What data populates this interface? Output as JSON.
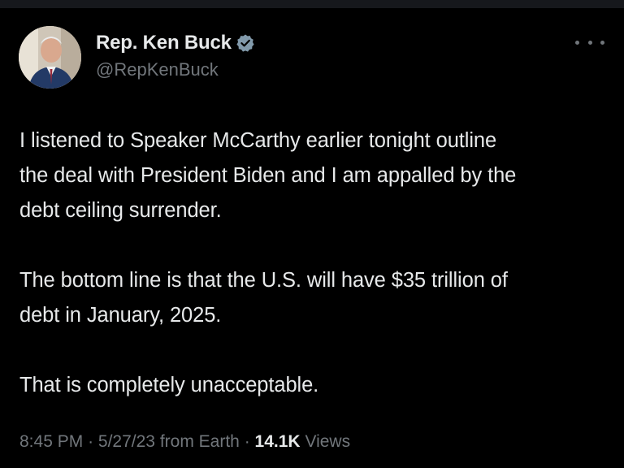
{
  "author": {
    "display_name": "Rep. Ken Buck",
    "handle": "@RepKenBuck",
    "verified_color": "#829aab"
  },
  "tweet": {
    "paragraphs": [
      [
        "I listened to Speaker McCarthy earlier tonight outline",
        "the deal with President Biden and I am appalled by the",
        "debt ceiling surrender."
      ],
      [
        "The bottom line is that the U.S. will have $35 trillion of",
        "debt in January, 2025."
      ],
      [
        "That is completely unacceptable."
      ]
    ]
  },
  "meta": {
    "time": "8:45 PM",
    "separator": "·",
    "date": "5/27/23",
    "source": "from Earth",
    "views_count": "14.1K",
    "views_label": "Views"
  },
  "icons": {
    "more": "more-horizontal-icon",
    "verified": "verified-badge-icon"
  }
}
